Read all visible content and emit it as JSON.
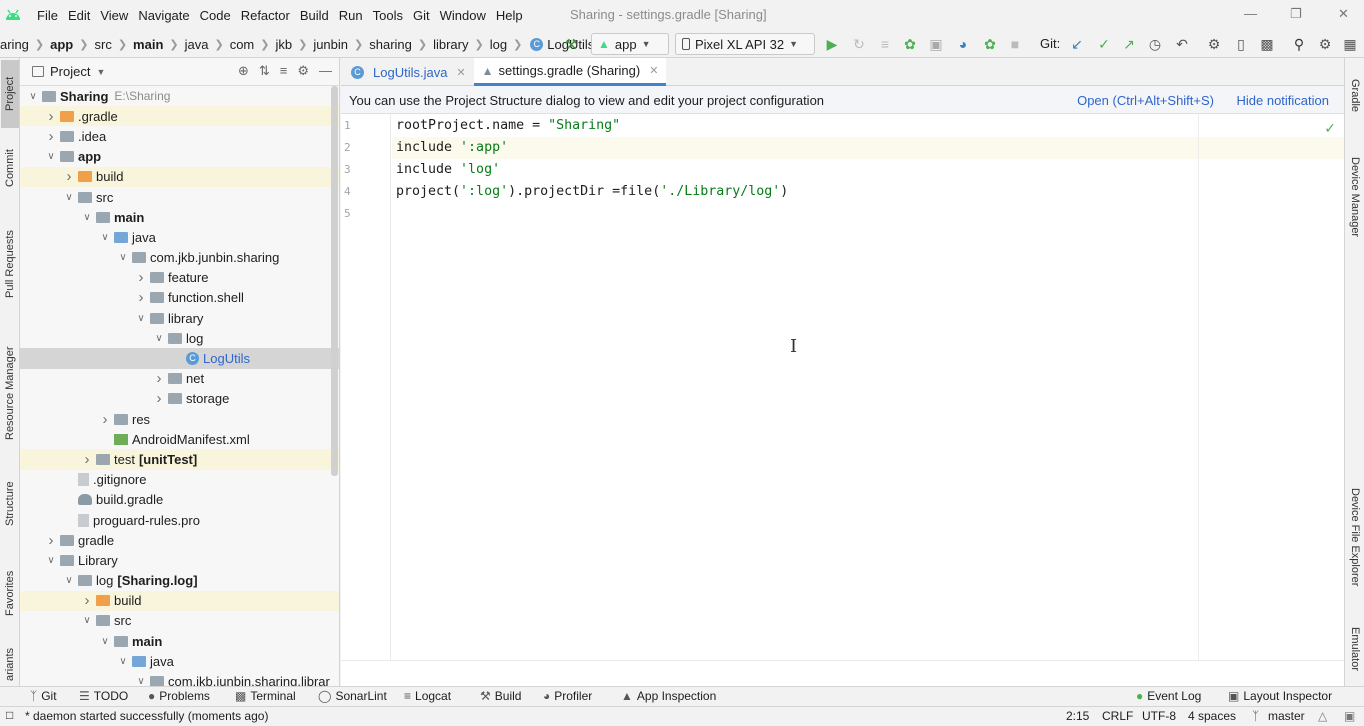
{
  "menubar": {
    "items": [
      "File",
      "Edit",
      "View",
      "Navigate",
      "Code",
      "Refactor",
      "Build",
      "Run",
      "Tools",
      "Git",
      "Window",
      "Help"
    ],
    "window_title": "Sharing - settings.gradle [Sharing]"
  },
  "navbar": {
    "breadcrumbs": [
      "aring",
      "app",
      "src",
      "main",
      "java",
      "com",
      "jkb",
      "junbin",
      "sharing",
      "library",
      "log",
      "LogUtils"
    ],
    "run_config": "app",
    "device": "Pixel XL API 32",
    "git_label": "Git:"
  },
  "left_stripe": {
    "tabs": [
      "Project",
      "Commit",
      "Pull Requests",
      "Resource Manager",
      "Structure",
      "Favorites",
      "ariants"
    ]
  },
  "right_stripe": {
    "tabs": [
      "Gradle",
      "Device Manager",
      "Device File Explorer",
      "Emulator"
    ]
  },
  "project_panel": {
    "title": "Project",
    "tree": [
      {
        "label": "Sharing",
        "hint": "E:\\Sharing",
        "bold": true,
        "arrow": "down",
        "icon": "folder mod"
      },
      {
        "label": ".gradle",
        "arrow": "right",
        "icon": "folder orange",
        "yellow": true
      },
      {
        "label": ".idea",
        "arrow": "right",
        "icon": "folder"
      },
      {
        "label": "app",
        "bold": true,
        "arrow": "down",
        "icon": "folder mod"
      },
      {
        "label": "build",
        "arrow": "right",
        "icon": "folder orange",
        "yellow": true
      },
      {
        "label": "src",
        "arrow": "down",
        "icon": "folder"
      },
      {
        "label": "main",
        "bold": true,
        "arrow": "down",
        "icon": "folder mod"
      },
      {
        "label": "java",
        "arrow": "down",
        "icon": "folder blue"
      },
      {
        "label": "com.jkb.junbin.sharing",
        "arrow": "down",
        "icon": "folder"
      },
      {
        "label": "feature",
        "arrow": "right",
        "icon": "folder"
      },
      {
        "label": "function.shell",
        "arrow": "right",
        "icon": "folder"
      },
      {
        "label": "library",
        "arrow": "down",
        "icon": "folder"
      },
      {
        "label": "log",
        "arrow": "down",
        "icon": "folder"
      },
      {
        "label": "LogUtils",
        "arrow": "none",
        "icon": "class",
        "selected": true,
        "link": true
      },
      {
        "label": "net",
        "arrow": "right",
        "icon": "folder"
      },
      {
        "label": "storage",
        "arrow": "right",
        "icon": "folder"
      },
      {
        "label": "res",
        "arrow": "right",
        "icon": "folder"
      },
      {
        "label": "AndroidManifest.xml",
        "arrow": "none",
        "icon": "manifest"
      },
      {
        "label": "test",
        "label2": "[unitTest]",
        "arrow": "right",
        "icon": "folder",
        "yellow": true
      },
      {
        "label": ".gitignore",
        "arrow": "none",
        "icon": "file"
      },
      {
        "label": "build.gradle",
        "arrow": "none",
        "icon": "gradle"
      },
      {
        "label": "proguard-rules.pro",
        "arrow": "none",
        "icon": "file"
      },
      {
        "label": "gradle",
        "arrow": "right",
        "icon": "folder"
      },
      {
        "label": "Library",
        "arrow": "down",
        "icon": "folder"
      },
      {
        "label": "log",
        "label2": "[Sharing.log]",
        "arrow": "down",
        "icon": "folder mod"
      },
      {
        "label": "build",
        "arrow": "right",
        "icon": "folder orange",
        "yellow": true
      },
      {
        "label": "src",
        "arrow": "down",
        "icon": "folder"
      },
      {
        "label": "main",
        "bold": true,
        "arrow": "down",
        "icon": "folder mod"
      },
      {
        "label": "java",
        "arrow": "down",
        "icon": "folder blue"
      },
      {
        "label": "com.jkb.junbin.sharing.librar",
        "arrow": "down",
        "icon": "folder"
      }
    ],
    "indents": [
      0,
      1,
      1,
      1,
      2,
      2,
      3,
      4,
      5,
      6,
      6,
      6,
      7,
      8,
      7,
      7,
      4,
      4,
      3,
      2,
      2,
      2,
      1,
      1,
      2,
      3,
      3,
      4,
      5,
      6
    ]
  },
  "editor": {
    "tabs": [
      {
        "label": "LogUtils.java",
        "icon": "class"
      },
      {
        "label": "settings.gradle (Sharing)",
        "icon": "gradle",
        "active": true
      }
    ],
    "notification": {
      "message": "You can use the Project Structure dialog to view and edit your project configuration",
      "open_link": "Open (Ctrl+Alt+Shift+S)",
      "hide_link": "Hide notification"
    },
    "line_numbers": [
      "1",
      "2",
      "3",
      "4",
      "5"
    ],
    "code": [
      [
        {
          "t": "rootProject.name = "
        },
        {
          "t": "\"Sharing\"",
          "s": true
        }
      ],
      [
        {
          "t": "include "
        },
        {
          "t": "':app'",
          "s": true
        }
      ],
      [
        {
          "t": "include "
        },
        {
          "t": "'log'",
          "s": true
        }
      ],
      [
        {
          "t": "project("
        },
        {
          "t": "':log'",
          "s": true
        },
        {
          "t": ").projectDir =file("
        },
        {
          "t": "'./Library/log'",
          "s": true
        },
        {
          "t": ")"
        }
      ],
      []
    ],
    "current_line": 2
  },
  "bottom_tools": [
    {
      "label": "Git",
      "icon": "git-branch-icon"
    },
    {
      "label": "TODO",
      "icon": "list-icon"
    },
    {
      "label": "Problems",
      "icon": "warning-icon"
    },
    {
      "label": "Terminal",
      "icon": "terminal-icon"
    },
    {
      "label": "SonarLint",
      "icon": "sonar-icon"
    },
    {
      "label": "Logcat",
      "icon": "logcat-icon"
    },
    {
      "label": "Build",
      "icon": "hammer-icon"
    },
    {
      "label": "Profiler",
      "icon": "profiler-icon"
    },
    {
      "label": "App Inspection",
      "icon": "inspection-icon"
    },
    {
      "label": "Event Log",
      "icon": "event-log-icon"
    },
    {
      "label": "Layout Inspector",
      "icon": "layout-inspector-icon"
    }
  ],
  "status": {
    "message": "* daemon started successfully (moments ago)",
    "position": "2:15",
    "line_ending": "CRLF",
    "encoding": "UTF-8",
    "indent": "4 spaces",
    "branch": "master"
  },
  "colors": {
    "accent": "#4083c9",
    "android_green": "#3ddc84",
    "string": "#067d17",
    "link": "#2f65ca"
  }
}
